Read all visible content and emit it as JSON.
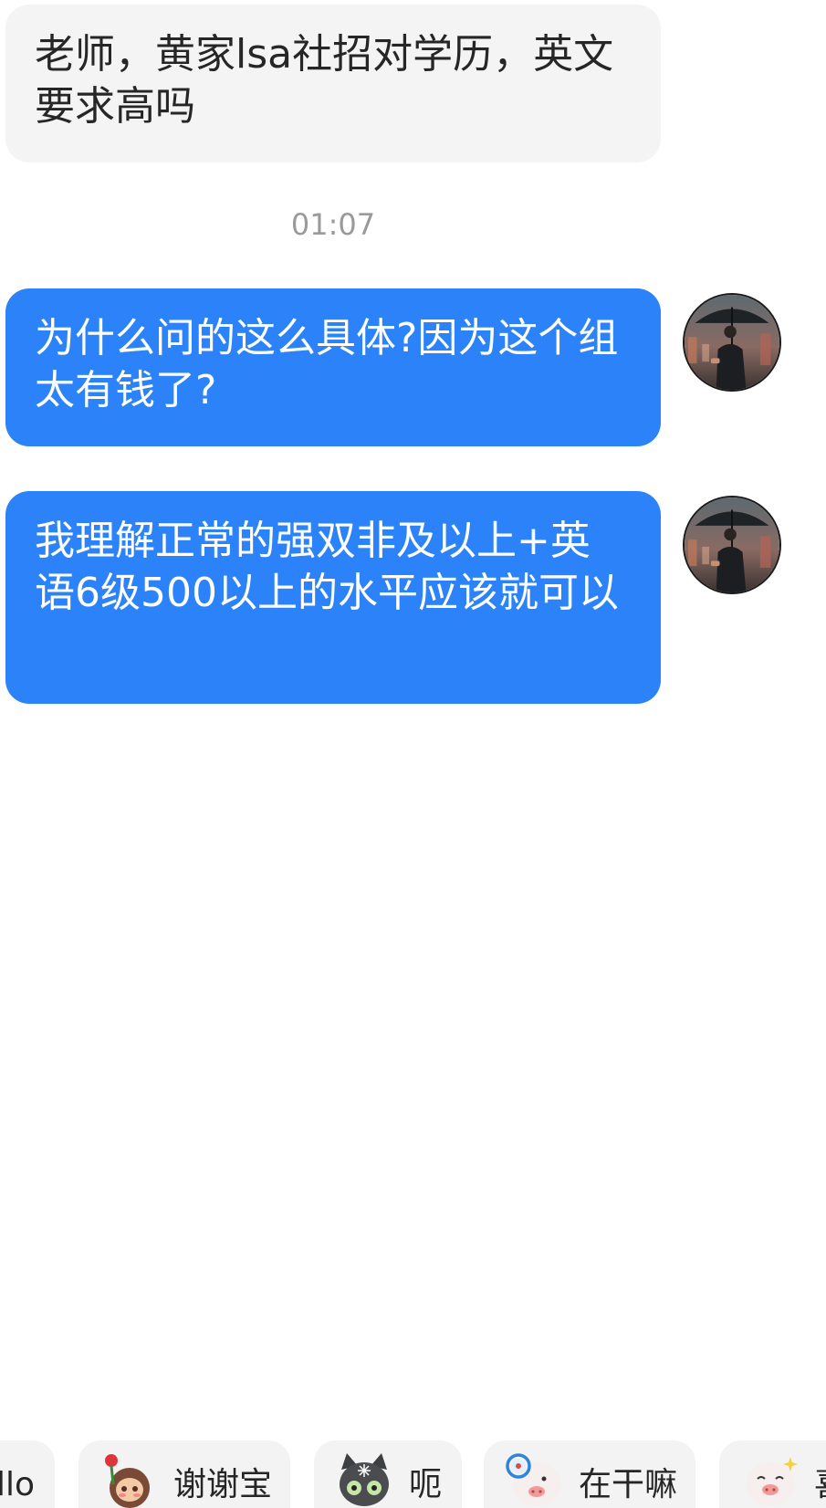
{
  "messages": [
    {
      "side": "incoming",
      "text": "老师，黄家lsa社招对学历，英文要求高吗"
    },
    {
      "side": "outgoing",
      "text": "为什么问的这么具体?因为这个组太有钱了?"
    },
    {
      "side": "outgoing",
      "text": "我理解正常的强双非及以上+英语6级500以上的水平应该就可以"
    }
  ],
  "timestamp": "01:07",
  "quick_replies": [
    {
      "label": "llo",
      "icon": "none"
    },
    {
      "label": "谢谢宝",
      "icon": "girl-with-rose-sticker-icon"
    },
    {
      "label": "呃",
      "icon": "gray-cat-sticker-icon"
    },
    {
      "label": "在干嘛",
      "icon": "pig-with-magnifier-sticker-icon"
    },
    {
      "label": "喜",
      "icon": "pig-sparkle-sticker-icon"
    }
  ],
  "colors": {
    "outgoing_bubble": "#2c83f9",
    "incoming_bubble": "#f4f4f4",
    "timestamp_text": "#9a9a9a",
    "chip_background": "#f3f3f3"
  }
}
